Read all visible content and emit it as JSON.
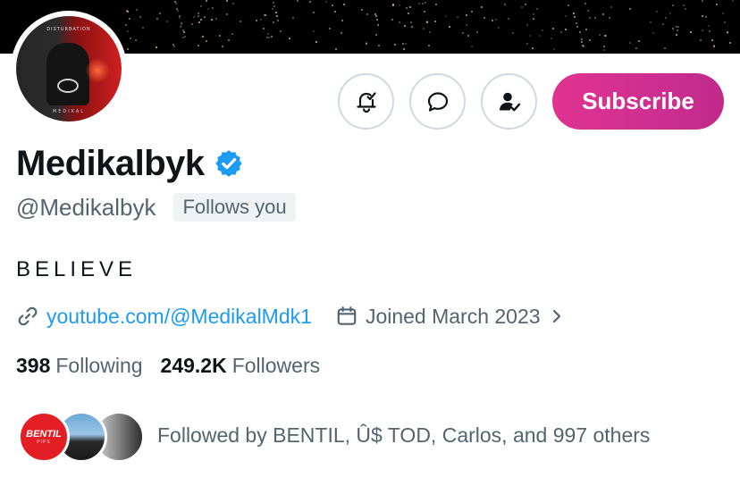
{
  "profile": {
    "display_name": "Medikalbyk",
    "handle": "@Medikalbyk",
    "follows_you_badge": "Follows you",
    "bio": "BELIEVE",
    "website": "youtube.com/@MedikalMdk1",
    "joined": "Joined March 2023",
    "avatar_cover_title": "DISTURBATION",
    "avatar_cover_foot": "MEDIKAL"
  },
  "stats": {
    "following_count": "398",
    "following_label": "Following",
    "followers_count": "249.2K",
    "followers_label": "Followers"
  },
  "actions": {
    "subscribe_label": "Subscribe"
  },
  "followed_by": {
    "text": "Followed by BENTIL, Û$ TOD, Carlos, and 997 others",
    "avatar1_text": "BENTIL",
    "avatar1_sub": "PIPS"
  },
  "icons": {
    "notify": "bell-check-icon",
    "message": "chat-bubble-icon",
    "following": "person-check-icon",
    "verified": "verified-badge-icon",
    "link": "link-icon",
    "calendar": "calendar-icon",
    "chevron": "chevron-right-icon"
  },
  "colors": {
    "verified": "#1d9bf0",
    "link": "#1d9bf0",
    "subscribe_start": "#e0338f",
    "subscribe_end": "#c02a8a",
    "muted_text": "#536471"
  }
}
